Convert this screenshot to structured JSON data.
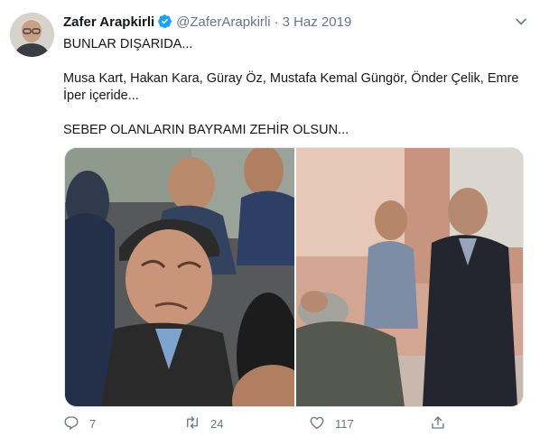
{
  "tweet": {
    "author_name": "Zafer Arapkirli",
    "handle": "@ZaferArapkirli",
    "separator": "·",
    "date": "3 Haz 2019",
    "text_line1": "BUNLAR DIŞARIDA...",
    "text_line2": "Musa Kart, Hakan Kara, Güray Öz, Mustafa Kemal Güngör, Önder Çelik, Emre İper içeride...",
    "text_line3": "SEBEP OLANLARIN BAYRAMI ZEHİR OLSUN..."
  },
  "actions": {
    "replies": "7",
    "retweets": "24",
    "likes": "117"
  },
  "colors": {
    "text": "#14171a",
    "secondary": "#657786",
    "verified": "#1da1f2",
    "border": "#e1e8ed"
  },
  "icons": [
    "verified-badge-icon",
    "chevron-down-icon",
    "reply-icon",
    "retweet-icon",
    "like-icon",
    "share-icon"
  ]
}
